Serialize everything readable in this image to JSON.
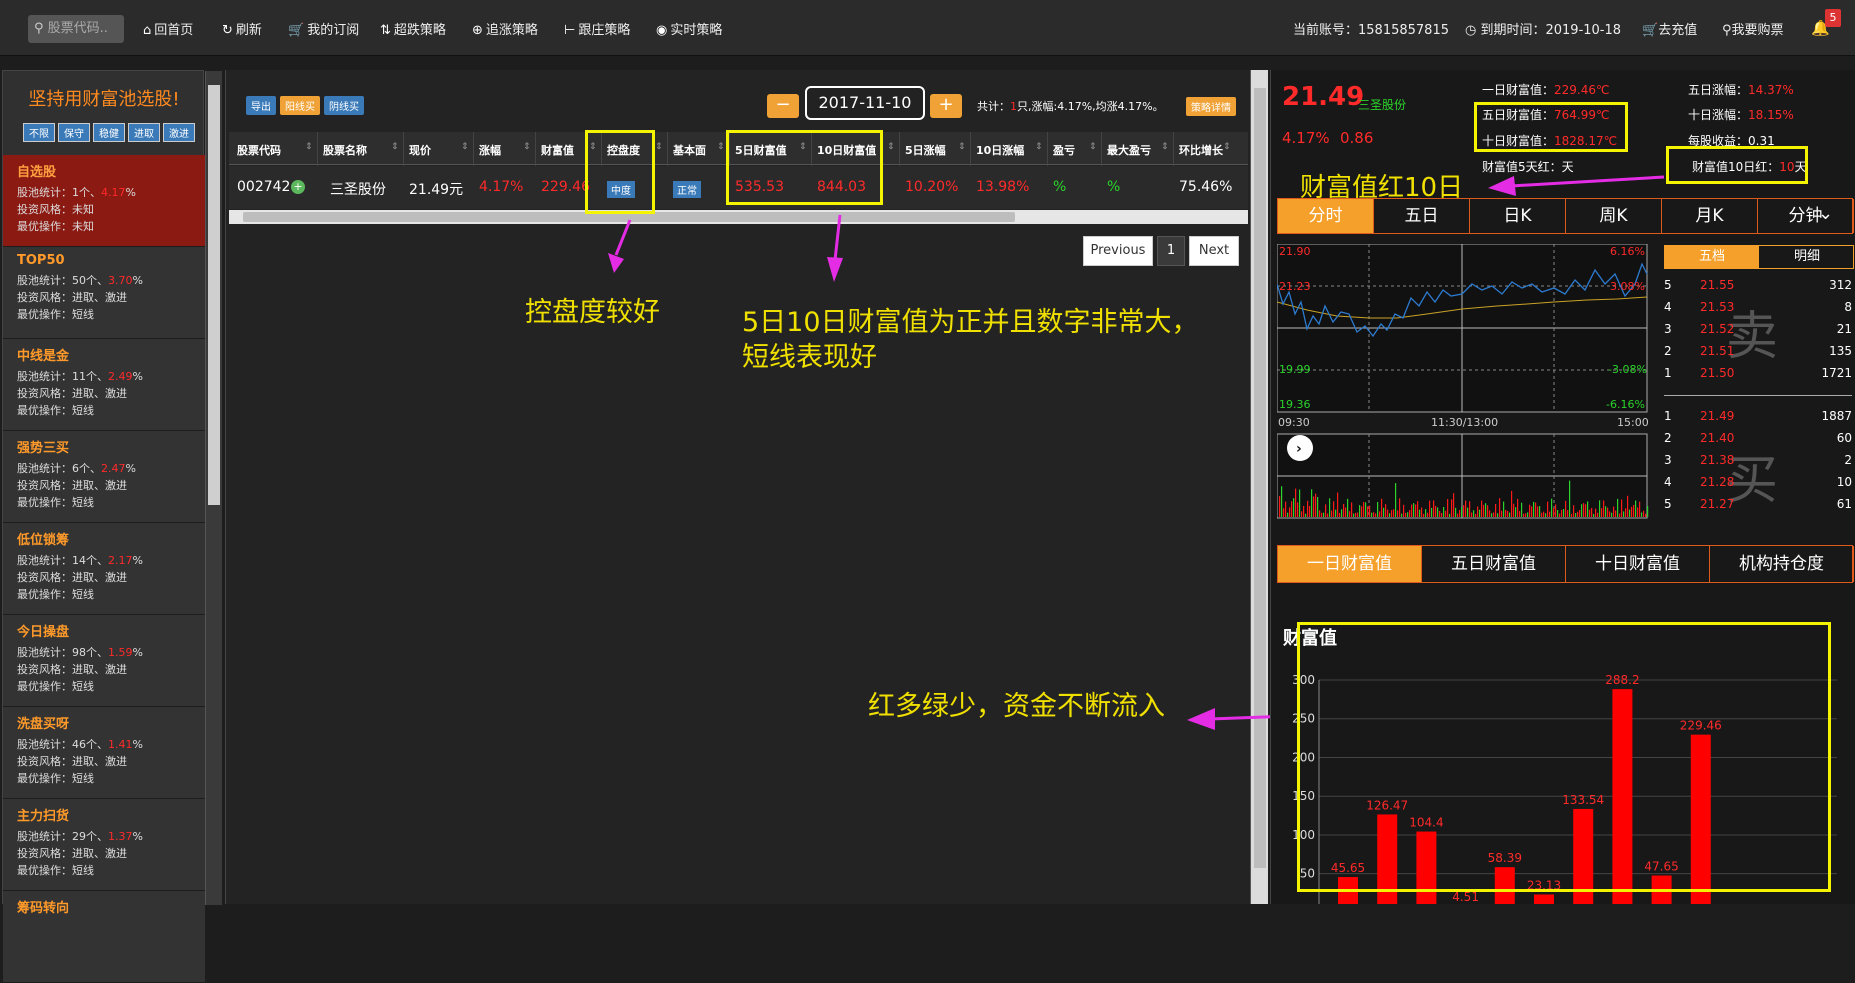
{
  "topbar": {
    "search_placeholder": "股票代码..",
    "nav": [
      "回首页",
      "刷新",
      "我的订阅",
      "超跌策略",
      "追涨策略",
      "跟庄策略",
      "实时策略"
    ],
    "account_label": "当前账号：15815857815",
    "expire_label": "到期时间：2019-10-18",
    "recharge": "去充值",
    "buy_stock": "我要购票",
    "badge": "5"
  },
  "sidebar": {
    "title": "坚持用财富池选股!",
    "tags": [
      "不限",
      "保守",
      "稳健",
      "进取",
      "激进"
    ],
    "items": [
      {
        "name": "自选股",
        "count_prefix": "股池统计：1个、",
        "pct": "4.17",
        "pct_suffix": "%",
        "style": "投资风格：未知",
        "op": "最优操作：未知"
      },
      {
        "name": "TOP50",
        "count_prefix": "股池统计：50个、",
        "pct": "3.70",
        "pct_suffix": "%",
        "style": "投资风格：进取、激进",
        "op": "最优操作：短线"
      },
      {
        "name": "中线是金",
        "count_prefix": "股池统计：11个、",
        "pct": "2.49",
        "pct_suffix": "%",
        "style": "投资风格：进取、激进",
        "op": "最优操作：短线"
      },
      {
        "name": "强势三买",
        "count_prefix": "股池统计：6个、",
        "pct": "2.47",
        "pct_suffix": "%",
        "style": "投资风格：进取、激进",
        "op": "最优操作：短线"
      },
      {
        "name": "低位锁筹",
        "count_prefix": "股池统计：14个、",
        "pct": "2.17",
        "pct_suffix": "%",
        "style": "投资风格：进取、激进",
        "op": "最优操作：短线"
      },
      {
        "name": "今日操盘",
        "count_prefix": "股池统计：98个、",
        "pct": "1.59",
        "pct_suffix": "%",
        "style": "投资风格：进取、激进",
        "op": "最优操作：短线"
      },
      {
        "name": "洗盘买呀",
        "count_prefix": "股池统计：46个、",
        "pct": "1.41",
        "pct_suffix": "%",
        "style": "投资风格：进取、激进",
        "op": "最优操作：短线"
      },
      {
        "name": "主力扫货",
        "count_prefix": "股池统计：29个、",
        "pct": "1.37",
        "pct_suffix": "%",
        "style": "投资风格：进取、激进",
        "op": "最优操作：短线"
      },
      {
        "name": "筹码转向",
        "count_prefix": "",
        "pct": "",
        "pct_suffix": "",
        "style": "",
        "op": ""
      }
    ]
  },
  "toolbar": {
    "export": "导出",
    "yang_buy": "阳线买",
    "yin_buy": "阴线买",
    "date": "2017-11-10",
    "minus": "−",
    "plus": "+",
    "summary_prefix": "共计：",
    "summary_count": "1",
    "summary_suffix": "只,涨幅:4.17%,均涨4.17%。",
    "detail": "策略详情"
  },
  "table": {
    "headers": [
      "股票代码",
      "股票名称",
      "现价",
      "涨幅",
      "财富值",
      "控盘度",
      "基本面",
      "5日财富值",
      "10日财富值",
      "5日涨幅",
      "10日涨幅",
      "盈亏",
      "最大盈亏",
      "环比增长"
    ],
    "row": {
      "code": "002742",
      "name": "三圣股份",
      "price": "21.49元",
      "change": "4.17%",
      "wealth": "229.46",
      "control": "中度",
      "fundamental": "正常",
      "wealth5": "535.53",
      "wealth10": "844.03",
      "chg5": "10.20%",
      "chg10": "13.98%",
      "pnl": "%",
      "max_pnl": "%",
      "growth": "75.46%"
    },
    "pagination": {
      "prev": "Previous",
      "page": "1",
      "next": "Next"
    }
  },
  "annotations": {
    "control": "控盘度较好",
    "wealth_line1": "5日10日财富值为正并且数字非常大，",
    "wealth_line2": "短线表现好",
    "flow": "红多绿少，资金不断流入",
    "red10": "财富值红10日"
  },
  "quote": {
    "price": "21.49",
    "name": "三圣股份",
    "pct": "4.17%",
    "chg": "0.86",
    "w1_label": "一日财富值：",
    "w1": "229.46℃",
    "w5_label": "五日财富值：",
    "w5": "764.99℃",
    "w10_label": "十日财富值：",
    "w10": "1828.17℃",
    "red5": "财富值5天红：天",
    "chg5_label": "五日涨幅：",
    "chg5": "14.37%",
    "chg10_label": "十日涨幅：",
    "chg10": "18.15%",
    "eps": "每股收益：0.31",
    "red10_label": "财富值10日红：",
    "red10_val": "10",
    "red10_unit": "天"
  },
  "period_tabs": [
    "分时",
    "五日",
    "日K",
    "周K",
    "月K",
    "分钟"
  ],
  "intraday": {
    "left_top": "21.90",
    "left_mid": "21.23",
    "left_low": "19.99",
    "left_bottom": "19.36",
    "right_top": "6.16%",
    "right_mid": "3.08%",
    "right_low": "-3.08%",
    "right_bottom": "-6.16%",
    "t_start": "09:30",
    "t_mid": "11:30/13:00",
    "t_end": "15:00"
  },
  "orderbook": {
    "tab_five": "五档",
    "tab_detail": "明细",
    "sell_label": "卖",
    "buy_label": "买",
    "sell": [
      {
        "n": "5",
        "p": "21.55",
        "v": "312"
      },
      {
        "n": "4",
        "p": "21.53",
        "v": "8"
      },
      {
        "n": "3",
        "p": "21.52",
        "v": "21"
      },
      {
        "n": "2",
        "p": "21.51",
        "v": "135"
      },
      {
        "n": "1",
        "p": "21.50",
        "v": "1721"
      }
    ],
    "buy": [
      {
        "n": "1",
        "p": "21.49",
        "v": "1887"
      },
      {
        "n": "2",
        "p": "21.40",
        "v": "60"
      },
      {
        "n": "3",
        "p": "21.38",
        "v": "2"
      },
      {
        "n": "4",
        "p": "21.28",
        "v": "10"
      },
      {
        "n": "5",
        "p": "21.27",
        "v": "61"
      }
    ]
  },
  "wealth_tabs": [
    "一日财富值",
    "五日财富值",
    "十日财富值",
    "机构持仓度"
  ],
  "chart_data": {
    "type": "bar",
    "title": "财富值",
    "ylim": [
      0,
      300
    ],
    "yticks": [
      50,
      100,
      150,
      200,
      250,
      300
    ],
    "values": [
      45.65,
      126.47,
      104.4,
      -4.51,
      58.39,
      23.13,
      133.54,
      288.2,
      47.65,
      229.46
    ],
    "labels": [
      "45.65",
      "126.47",
      "104.4",
      "4.51",
      "58.39",
      "23.13",
      "133.54",
      "288.2",
      "47.65",
      "229.46"
    ],
    "colors": {
      "bar": "#ff0000",
      "label": "#ff2a2a"
    }
  }
}
